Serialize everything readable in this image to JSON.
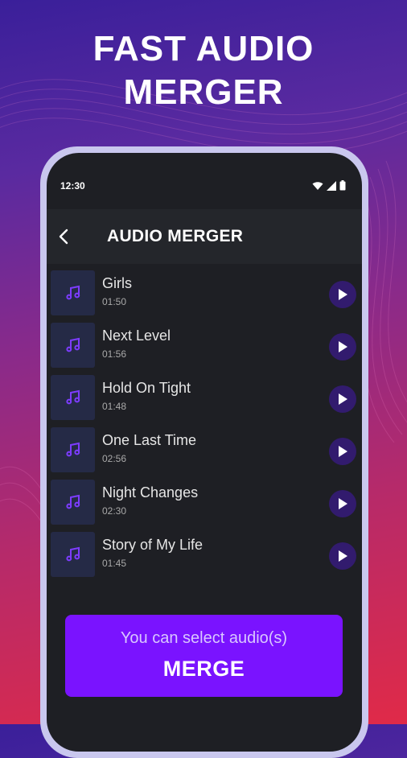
{
  "promo": {
    "line1": "FAST AUDIO",
    "line2": "MERGER"
  },
  "status_bar": {
    "time": "12:30",
    "icons": [
      "wifi-icon",
      "signal-icon",
      "battery-icon"
    ]
  },
  "app_bar": {
    "title": "AUDIO MERGER",
    "back_icon": "back-arrow-icon"
  },
  "tracks": [
    {
      "name": "Girls",
      "duration": "01:50"
    },
    {
      "name": "Next Level",
      "duration": "01:56"
    },
    {
      "name": "Hold On Tight",
      "duration": "01:48"
    },
    {
      "name": "One Last Time",
      "duration": "02:56"
    },
    {
      "name": "Night Changes",
      "duration": "02:30"
    },
    {
      "name": "Story of My Life",
      "duration": "01:45"
    }
  ],
  "merge_button": {
    "hint": "You can select audio(s)",
    "label": "MERGE"
  },
  "colors": {
    "accent": "#7a13ff",
    "play_bg": "#321b6e",
    "note_icon": "#7d3cff",
    "screen_bg": "#1e1f24"
  }
}
